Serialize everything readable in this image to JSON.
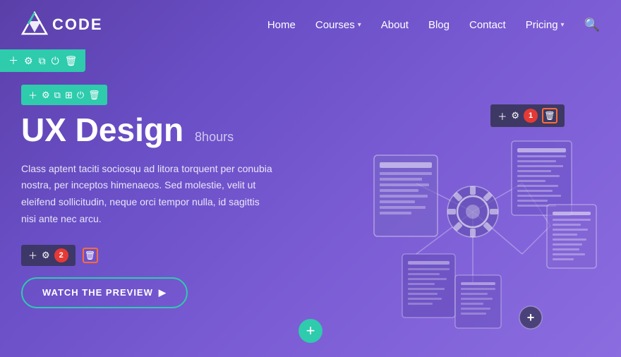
{
  "site": {
    "logo_text": "CODE"
  },
  "header": {
    "nav": [
      {
        "label": "Home",
        "has_dropdown": false
      },
      {
        "label": "Courses",
        "has_dropdown": true
      },
      {
        "label": "About",
        "has_dropdown": false
      },
      {
        "label": "Blog",
        "has_dropdown": false
      },
      {
        "label": "Contact",
        "has_dropdown": false
      },
      {
        "label": "Pricing",
        "has_dropdown": true
      }
    ]
  },
  "toolbar_top": {
    "icons": [
      "plus",
      "gear",
      "copy",
      "power",
      "trash"
    ]
  },
  "section_toolbar": {
    "icons": [
      "plus",
      "gear",
      "copy",
      "grid",
      "power",
      "trash"
    ]
  },
  "hero": {
    "heading": "UX Design",
    "hours": "8hours",
    "description": "Class aptent taciti sociosqu ad litora torquent per conubia nostra, per inceptos himenaeos. Sed molestie, velit ut eleifend sollicitudin, neque orci tempor nulla, id sagittis nisi ante nec arcu.",
    "watch_btn_label": "WATCH THE PREVIEW",
    "watch_btn_arrow": "▶"
  },
  "float_toolbar_1": {
    "badge": "1",
    "icons": [
      "plus",
      "gear",
      "trash"
    ]
  },
  "float_toolbar_2": {
    "badge": "2",
    "icons": [
      "plus",
      "gear",
      "trash"
    ]
  },
  "bottom_plus": "+",
  "colors": {
    "accent_teal": "#2ecbad",
    "accent_red": "#e53935",
    "accent_orange": "#ff6b35",
    "bg_dark_overlay": "rgba(50,50,80,0.8)"
  }
}
